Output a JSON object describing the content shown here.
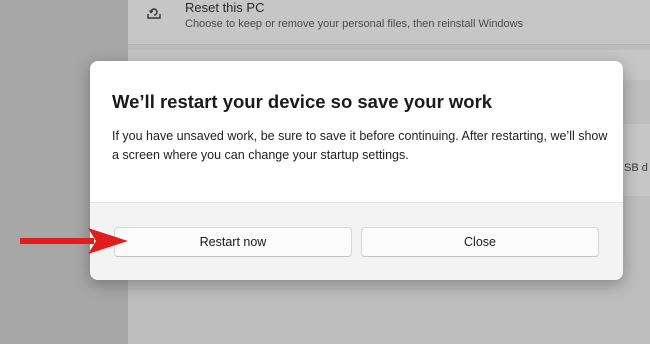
{
  "background": {
    "reset": {
      "title": "Reset this PC",
      "description": "Choose to keep or remove your personal files, then reinstall Windows"
    },
    "partial_text": "SB d"
  },
  "dialog": {
    "title": "We’ll restart your device so save your work",
    "body": "If you have unsaved work, be sure to save it before continuing. After restarting, we’ll show a screen where you can change your startup settings.",
    "buttons": {
      "restart_label": "Restart now",
      "close_label": "Close"
    }
  },
  "annotation": {
    "arrow_color": "#e01e1e",
    "icon": "red-arrow-icon"
  }
}
